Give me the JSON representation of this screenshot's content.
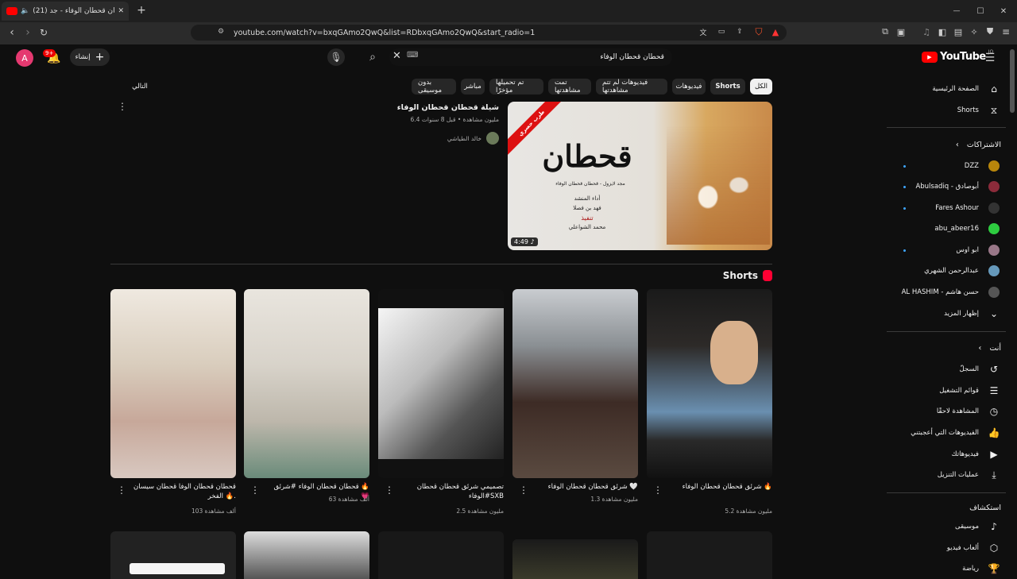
{
  "tab": {
    "title": "(21) قحطان قحطان الوفاء - جد",
    "new_tab": "+"
  },
  "window": {
    "min": "—",
    "max": "☐",
    "close": "✕"
  },
  "address": {
    "url": "youtube.com/watch?v=bxqGAmo2QwQ&list=RDbxqGAmo2QwQ&start_radio=1"
  },
  "header": {
    "avatar": "A",
    "notif_count": "9+",
    "create": "إنشاء",
    "search_value": "قحطان قحطان الوفاء",
    "keyboard": "⌨",
    "logo": "YouTube",
    "logo_sup": "JO"
  },
  "chips": [
    "الكل",
    "Shorts",
    "فيديوهات",
    "فيديوهات لم تتم مشاهدتها",
    "تمت مشاهدتها",
    "تم تحميلها مؤخرًا",
    "مباشر",
    "بدون موسيقى",
    "التالي"
  ],
  "video": {
    "title": "شيلة قحطان قحطان الوفاء",
    "meta": "6.4 مليون مشاهدة • قبل 8 سنوات",
    "channel": "خالد الطياشي",
    "duration": "4:49",
    "badge": "طرب حصري",
    "art_title": "قحطان",
    "art_sub": "مجد لايزول - قحطان قحطان الوفاء",
    "art_lines": [
      "أداء المنشد",
      "فهد بن فصلا",
      "تنفيذ",
      "محمد الشواعلي"
    ]
  },
  "shorts": {
    "heading": "Shorts",
    "items": [
      {
        "title": "شرئق قحطان قحطان الوفاء 🔥",
        "views": "5.2 مليون مشاهدة"
      },
      {
        "title": "شرئق قحطان قحطان الوفاء 🤍",
        "views": "1.3 مليون مشاهدة"
      },
      {
        "title": "تصميمي شرئق قحطان قحطان الوفاء#SXB",
        "views": "2.5 مليون مشاهدة"
      },
      {
        "title": "قحطان قحطان الوفاء #شرئق 🔥💗",
        "views": "63 ألف مشاهدة"
      },
      {
        "title": "قحطان قحطان الوفا قحطان سيسان الفخر 🔥.",
        "views": "103 ألف مشاهدة"
      }
    ]
  },
  "sidebar": {
    "home": "الصفحة الرئيسية",
    "shorts": "Shorts",
    "subs_header": "الاشتراكات",
    "subs": [
      {
        "name": "DZZ",
        "color": "#b8860b"
      },
      {
        "name": "Abulsadiq - أبوصادق",
        "color": "#8b2b3a"
      },
      {
        "name": "Fares Ashour",
        "color": "#333"
      },
      {
        "name": "abu_abeer16",
        "color": "#2ecc40"
      },
      {
        "name": "ابو اوس",
        "color": "#997788"
      },
      {
        "name": "عبدالرحمن الشهري",
        "color": "#6699bb"
      },
      {
        "name": "AL HASHIM - حسن هاشم",
        "color": "#555"
      }
    ],
    "show_more": "إظهار المزيد",
    "you_header": "أنت",
    "you": [
      "السجلّ",
      "قوائم التشغيل",
      "المشاهدة لاحقًا",
      "الفيديوهات التي أعجبتني",
      "فيديوهاتك",
      "عمليات التنزيل"
    ],
    "explore_header": "استكشاف",
    "explore": [
      "موسيقى",
      "ألعاب فيديو",
      "رياضة"
    ]
  }
}
